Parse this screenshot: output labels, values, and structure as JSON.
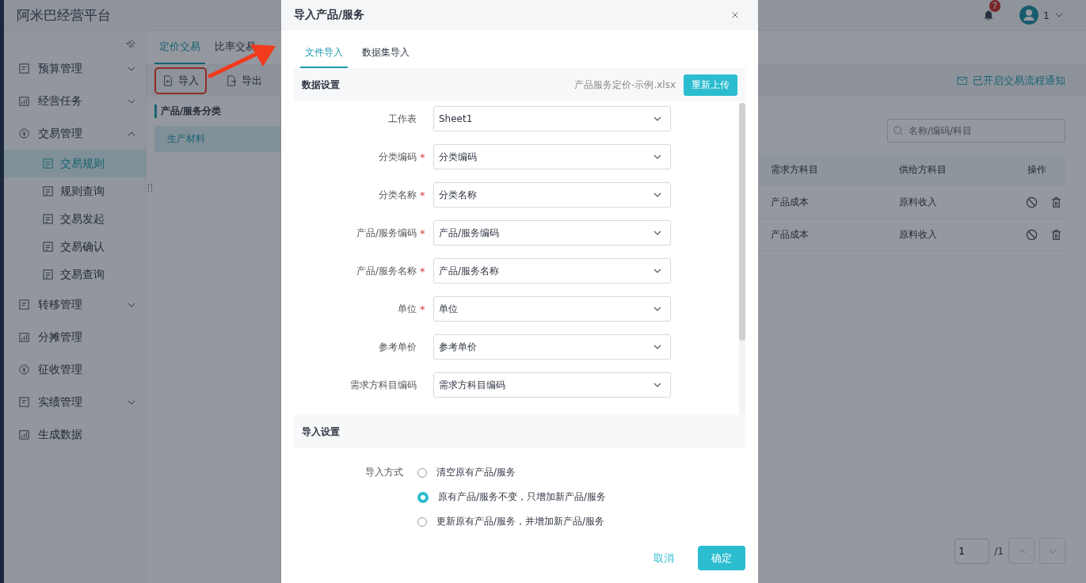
{
  "app": {
    "title": "阿米巴经营平台",
    "notifications": "7",
    "user": "1"
  },
  "sidebar": {
    "items": [
      {
        "label": "预算管理",
        "expanded": false,
        "selected": false
      },
      {
        "label": "经营任务",
        "expanded": false,
        "selected": false
      },
      {
        "label": "交易管理",
        "expanded": true,
        "selected": false,
        "children": [
          {
            "label": "交易规则",
            "selected": true
          },
          {
            "label": "规则查询",
            "selected": false
          },
          {
            "label": "交易发起",
            "selected": false
          },
          {
            "label": "交易确认",
            "selected": false
          },
          {
            "label": "交易查询",
            "selected": false
          }
        ]
      },
      {
        "label": "转移管理",
        "expanded": false,
        "selected": false
      },
      {
        "label": "分摊管理",
        "selected": false
      },
      {
        "label": "征收管理",
        "selected": false
      },
      {
        "label": "实绩管理",
        "expanded": false,
        "selected": false
      },
      {
        "label": "生成数据",
        "selected": false
      }
    ]
  },
  "page_tabs": [
    {
      "label": "定价交易",
      "selected": true
    },
    {
      "label": "比率交易",
      "selected": false
    }
  ],
  "toolbar": {
    "buttons": [
      {
        "label": "导入",
        "highlighted": true
      },
      {
        "label": "导出",
        "highlighted": false
      }
    ],
    "notice": "已开启交易流程通知"
  },
  "category_panel": {
    "title": "产品/服务分类",
    "items": [
      {
        "label": "生产材料",
        "selected": true
      }
    ]
  },
  "search": {
    "placeholder": "名称/编码/科目"
  },
  "table": {
    "columns": [
      "需求方科目",
      "供给方科目",
      "操作"
    ],
    "rows": [
      [
        "产品成本",
        "原料收入"
      ],
      [
        "产品成本",
        "原料收入"
      ]
    ]
  },
  "pagination": {
    "page": "1",
    "total": "/1"
  },
  "dialog": {
    "title": "导入产品/服务",
    "tabs": [
      {
        "label": "文件导入",
        "selected": true
      },
      {
        "label": "数据集导入",
        "selected": false
      }
    ],
    "data_settings": {
      "title": "数据设置",
      "file_name": "产品服务定价-示例.xlsx",
      "reupload": "重新上传",
      "fields": [
        {
          "label": "工作表",
          "value": "Sheet1"
        },
        {
          "label": "分类编码",
          "required_mark": "*",
          "value": "分类编码"
        },
        {
          "label": "分类名称",
          "required_mark": "*",
          "value": "分类名称"
        },
        {
          "label": "产品/服务编码",
          "required_mark": "*",
          "value": "产品/服务编码"
        },
        {
          "label": "产品/服务名称",
          "required_mark": "*",
          "value": "产品/服务名称"
        },
        {
          "label": "单位",
          "required_mark": "*",
          "value": "单位"
        },
        {
          "label": "参考单价",
          "value": "参考单价"
        },
        {
          "label": "需求方科目编码",
          "value": "需求方科目编码"
        }
      ]
    },
    "import_settings": {
      "title": "导入设置",
      "label": "导入方式",
      "options": [
        {
          "label": "清空原有产品/服务",
          "selected": false
        },
        {
          "label": "原有产品/服务不变，只增加新产品/服务",
          "selected": true
        },
        {
          "label": "更新原有产品/服务，并增加新产品/服务",
          "selected": false
        }
      ]
    },
    "buttons": {
      "cancel": "取消",
      "confirm": "确定"
    }
  }
}
